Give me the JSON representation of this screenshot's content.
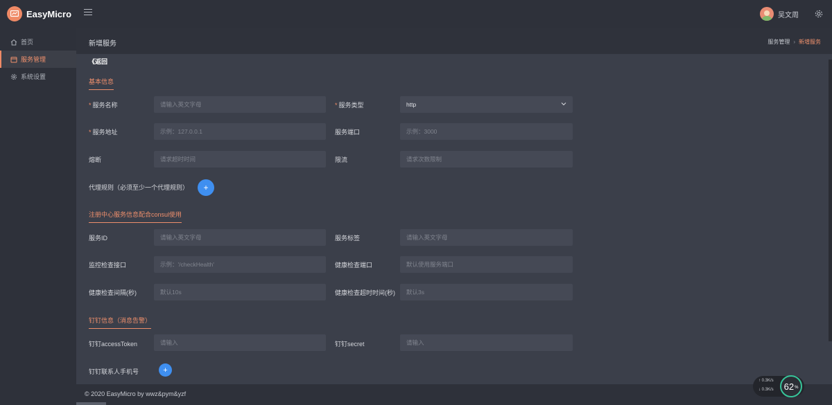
{
  "app": {
    "name": "EasyMicro"
  },
  "user": {
    "name": "吴文周"
  },
  "sidebar": {
    "items": [
      {
        "label": "首页",
        "icon": "home-icon",
        "active": false
      },
      {
        "label": "服务管理",
        "icon": "calendar-icon",
        "active": true
      },
      {
        "label": "系统设置",
        "icon": "gear-icon",
        "active": false
      }
    ]
  },
  "header": {
    "title": "新增服务",
    "breadcrumb": {
      "parent": "服务管理",
      "current": "新增服务"
    }
  },
  "form": {
    "back_label": "《返回",
    "sections": {
      "basic": "基本信息",
      "registry": "注册中心服务信息配合consul使用",
      "dingtalk": "钉钉信息（消息告警）"
    },
    "service_name": {
      "label": "服务名称",
      "placeholder": "请输入英文字母"
    },
    "service_type": {
      "label": "服务类型",
      "value": "http"
    },
    "service_address": {
      "label": "服务地址",
      "placeholder": "示例：127.0.0.1"
    },
    "service_port": {
      "label": "服务端口",
      "placeholder": "示例：3000"
    },
    "circuit_breaker": {
      "label": "熔断",
      "placeholder": "请求超时时间"
    },
    "rate_limit": {
      "label": "限流",
      "placeholder": "请求次数限制"
    },
    "proxy_rules": {
      "label": "代理规则（必须至少一个代理规则）",
      "add": "+"
    },
    "service_id": {
      "label": "服务ID",
      "placeholder": "请输入英文字母"
    },
    "service_tags": {
      "label": "服务标签",
      "placeholder": "请输入英文字母"
    },
    "health_path": {
      "label": "监控检查接口",
      "placeholder": "示例：'/checkHealth'"
    },
    "health_port": {
      "label": "健康检查端口",
      "placeholder": "默认使用服务端口"
    },
    "health_interval": {
      "label": "健康检查间隔(秒)",
      "placeholder": "默认10s"
    },
    "health_timeout": {
      "label": "健康检查超时时间(秒)",
      "placeholder": "默认3s"
    },
    "ding_token": {
      "label": "钉钉accessToken",
      "placeholder": "请输入"
    },
    "ding_secret": {
      "label": "钉钉secret",
      "placeholder": "请输入"
    },
    "ding_phone": {
      "label": "钉钉联系人手机号",
      "add": "+"
    }
  },
  "footer": {
    "copyright": "© 2020 EasyMicro by wwz&pym&yzf"
  },
  "net_widget": {
    "up": "0.3",
    "down": "0.3",
    "unit": "K/s",
    "percent": "62",
    "percent_sign": "%"
  },
  "colors": {
    "accent": "#ef8a66",
    "primary_button": "#3f8ff0",
    "bg": "#3b3f4a",
    "panel": "#2e313a",
    "input": "#454955"
  }
}
